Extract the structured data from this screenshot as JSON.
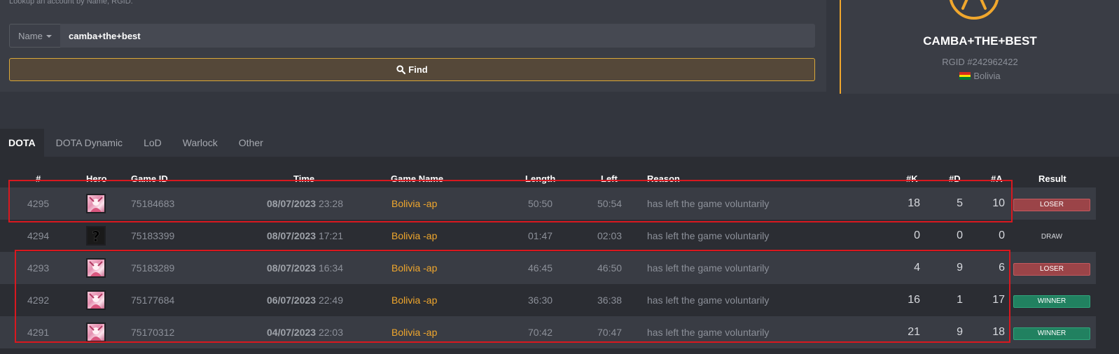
{
  "search": {
    "hint": "Lookup an account by Name, RGID.",
    "type_selected": "Name",
    "value": "camba+the+best",
    "find_label": "Find"
  },
  "profile": {
    "name": "CAMBA+THE+BEST",
    "rgid": "RGID #242962422",
    "country": "Bolivia",
    "accent_color": "#f0a72d"
  },
  "tabs": [
    {
      "label": "DOTA",
      "active": true
    },
    {
      "label": "DOTA Dynamic",
      "active": false
    },
    {
      "label": "LoD",
      "active": false
    },
    {
      "label": "Warlock",
      "active": false
    },
    {
      "label": "Other",
      "active": false
    }
  ],
  "table": {
    "headers": {
      "num": "#",
      "hero": "Hero",
      "game_id": "Game ID",
      "time": "Time",
      "game_name": "Game Name",
      "length": "Length",
      "left": "Left",
      "reason": "Reason",
      "k": "#K",
      "d": "#D",
      "a": "#A",
      "result": "Result"
    },
    "rows": [
      {
        "num": "4295",
        "hero": "hero-portrait",
        "game_id": "75184683",
        "date": "08/07/2023",
        "time": "23:28",
        "game_name": "Bolivia -ap",
        "length": "50:50",
        "left": "50:54",
        "reason": "has left the game voluntarily",
        "k": "18",
        "d": "5",
        "a": "10",
        "result": "LOSER",
        "result_type": "loser"
      },
      {
        "num": "4294",
        "hero": "unknown-hero",
        "game_id": "75183399",
        "date": "08/07/2023",
        "time": "17:21",
        "game_name": "Bolivia -ap",
        "length": "01:47",
        "left": "02:03",
        "reason": "has left the game voluntarily",
        "k": "0",
        "d": "0",
        "a": "0",
        "result": "DRAW",
        "result_type": "draw"
      },
      {
        "num": "4293",
        "hero": "hero-portrait",
        "game_id": "75183289",
        "date": "08/07/2023",
        "time": "16:34",
        "game_name": "Bolivia -ap",
        "length": "46:45",
        "left": "46:50",
        "reason": "has left the game voluntarily",
        "k": "4",
        "d": "9",
        "a": "6",
        "result": "LOSER",
        "result_type": "loser"
      },
      {
        "num": "4292",
        "hero": "hero-portrait",
        "game_id": "75177684",
        "date": "06/07/2023",
        "time": "22:49",
        "game_name": "Bolivia -ap",
        "length": "36:30",
        "left": "36:38",
        "reason": "has left the game voluntarily",
        "k": "16",
        "d": "1",
        "a": "17",
        "result": "WINNER",
        "result_type": "winner"
      },
      {
        "num": "4291",
        "hero": "hero-portrait",
        "game_id": "75170312",
        "date": "04/07/2023",
        "time": "22:03",
        "game_name": "Bolivia -ap",
        "length": "70:42",
        "left": "70:47",
        "reason": "has left the game voluntarily",
        "k": "21",
        "d": "9",
        "a": "18",
        "result": "WINNER",
        "result_type": "winner"
      }
    ]
  },
  "colors": {
    "loser": "#9b4448",
    "winner": "#218160",
    "highlight": "#d9181f"
  }
}
